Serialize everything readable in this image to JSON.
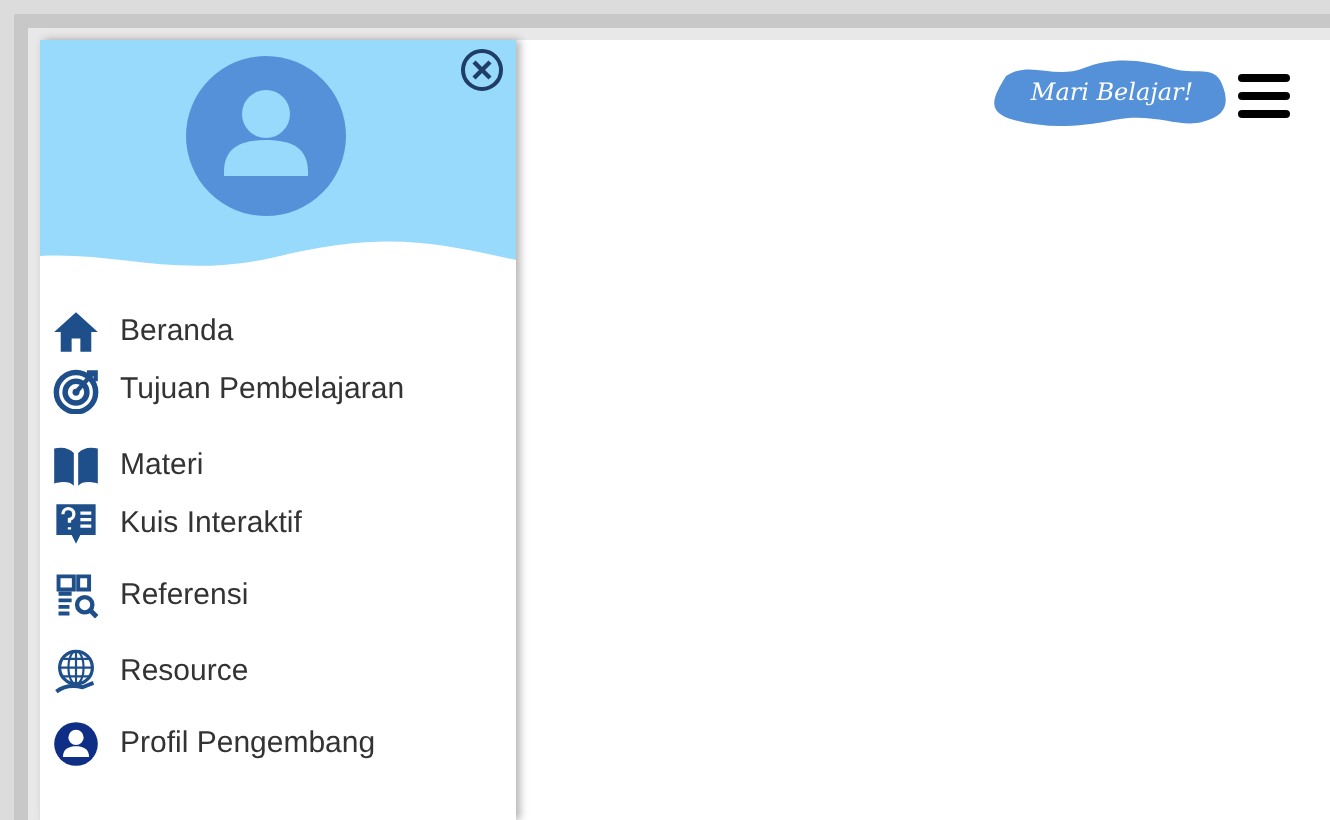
{
  "sidebar": {
    "items": [
      {
        "label": "Beranda"
      },
      {
        "label": "Tujuan Pembelajaran"
      },
      {
        "label": "Materi"
      },
      {
        "label": "Kuis Interaktif"
      },
      {
        "label": "Referensi"
      },
      {
        "label": "Resource"
      },
      {
        "label": "Profil Pengembang"
      }
    ]
  },
  "header": {
    "logo_text": "Mari Belajar!"
  }
}
